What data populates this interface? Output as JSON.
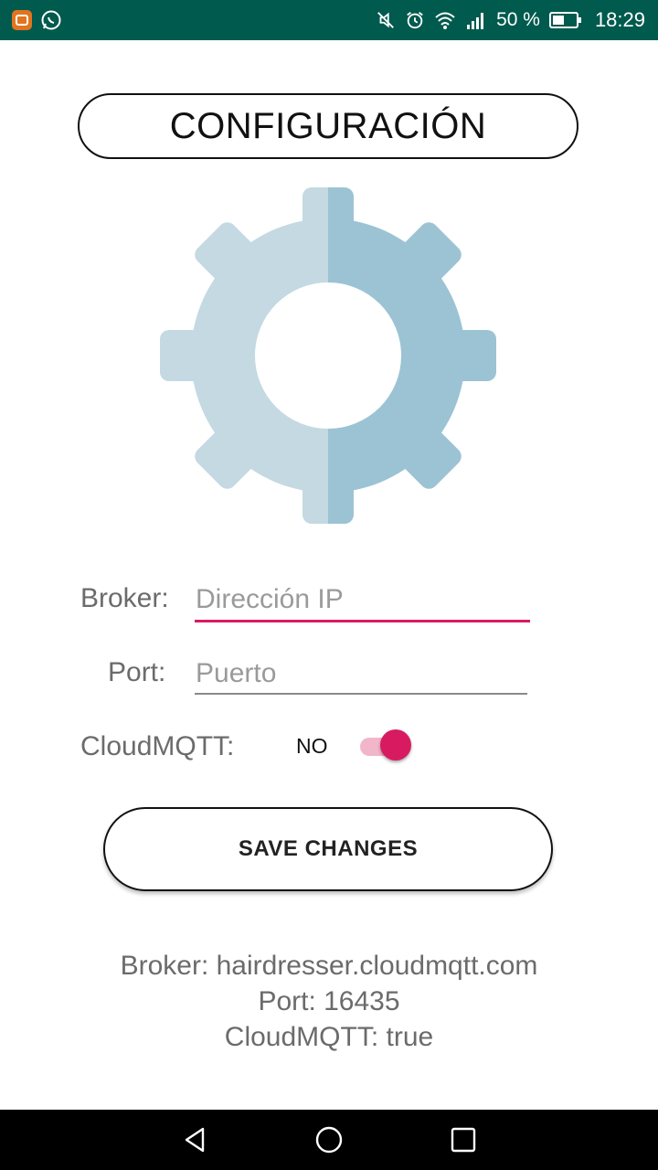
{
  "status_bar": {
    "battery_percent": "50 %",
    "time": "18:29",
    "left_icons": [
      "app-notification-icon",
      "whatsapp-icon"
    ],
    "right_icons": [
      "mute-icon",
      "alarm-icon",
      "wifi-icon",
      "signal-icon",
      "battery-icon"
    ]
  },
  "header": {
    "title": "CONFIGURACIÓN"
  },
  "form": {
    "broker_label": "Broker:",
    "broker_placeholder": "Dirección IP",
    "port_label": "Port:",
    "port_placeholder": "Puerto",
    "cloudmqtt_label": "CloudMQTT:",
    "cloudmqtt_state": "NO",
    "cloudmqtt_switch_on": true
  },
  "actions": {
    "save_label": "SAVE CHANGES"
  },
  "info": {
    "broker": "Broker: hairdresser.cloudmqtt.com",
    "port": "Port: 16435",
    "cloudmqtt": "CloudMQTT: true"
  },
  "colors": {
    "status_bar": "#005a4e",
    "accent": "#d81b60",
    "gear_light": "#c4d9e2",
    "gear_dark": "#9cc3d4"
  },
  "nav_bar": {
    "icons": [
      "back-icon",
      "home-icon",
      "recents-icon"
    ]
  }
}
